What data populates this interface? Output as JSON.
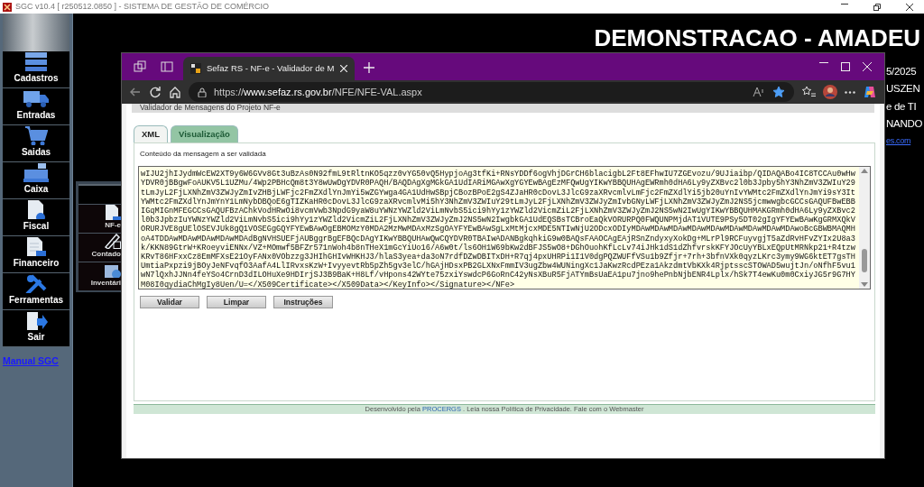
{
  "app": {
    "title": "SGC v10.4 [ r250512.0850 ] - SISTEMA DE GESTÃO DE COMÉRCIO",
    "banner": "DEMONSTRACAO - AMADEU",
    "side_texts": [
      "5/2025",
      "USZEN",
      "e de TI",
      "NANDO"
    ],
    "side_link": "es.com"
  },
  "sidebar": {
    "items": [
      {
        "label": "Cadastros"
      },
      {
        "label": "Entradas"
      },
      {
        "label": "Saidas"
      },
      {
        "label": "Caixa"
      },
      {
        "label": "Fiscal"
      },
      {
        "label": "Financeiro"
      },
      {
        "label": "Ferramentas"
      },
      {
        "label": "Sair"
      }
    ],
    "link": "Manual SGC"
  },
  "submenu": {
    "items": [
      {
        "label": "NF-e"
      },
      {
        "label": "Contado"
      },
      {
        "label": "Inventári"
      }
    ]
  },
  "browser": {
    "tab": {
      "title": "Sefaz RS - NF-e - Validador de M",
      "selected": true
    },
    "url_scheme": "https://",
    "url_domain": "www.sefaz.rs.gov.br",
    "url_path": "/NFE/NFE-VAL.aspx",
    "favorite": true
  },
  "page": {
    "header": "Validador de Mensagens do Projeto NF-e",
    "tabs": [
      {
        "label": "XML",
        "selected": true
      },
      {
        "label": "Visualização",
        "selected": false
      }
    ],
    "field_label": "Conteúdo da mensagem a ser validada",
    "message": "wIJU2jhIJydmWcEW2XT9y6W6GVv8Gt3uBzAs0N92fmL9tRltnKO5qzz0vYG50vQ5HypjoAg3tfKi+RNsYDDf6ogVhjDGrCH6blacigbL2Ft8EFhwIU7ZGEvozu/9UJiaibp/QIDAQABo4IC8TCCAu0wHwYDVR0jBBgwFoAUKV5L1UZMu/4Wp2PBHcQm8t3Y8wUwDgYDVR0PAQH/BAQDAgXgMGkGA1UdIARiMGAwXgYGYEwBAgEzMFQwUgYIKwYBBQUHAgEWRmh0dHA6Ly9yZXBvc2l0b3Jpby5hY3NhZmV3ZWIuY29tLmJyL2FjLXNhZmV3ZWJyZmIvZHBjLWFjc2FmZXdlYnJmYi5wZGYwga4GA1UdHwSBpjCBozBPoE2gS4ZJaHR0cDovL3JlcG9zaXRvcmlvLmFjc2FmZXdlYi5jb20uYnIvYWMtc2FmZXdlYnJmYi9sY3ItYWMtc2FmZXdlYnJmYnY1LmNybDBQoE6gTIZKaHR0cDovL3JlcG9zaXRvcmlvMi5hY3NhZmV3ZWIuY29tLmJyL2FjLXNhZmV3ZWJyZmIvbGNyLWFjLXNhZmV3ZWJyZmJ2NS5jcmwwgbcGCCsGAQUFBwEBBIGqMIGnMFEGCCsGAQUFBzAChkVodHRwOi8vcmVwb3NpdG9yaW8uYWNzYWZld2ViLmNvbS5ici9hYy1zYWZld2VicmZiL2FjLXNhZmV3ZWJyZmJ2NS5wN2IwUgYIKwYBBQUHMAKGRmh0dHA6Ly9yZXBvc2l0b3JpbzIuYWNzYWZld2ViLmNvbS5ici9hYy1zYWZld2VicmZiL2FjLXNhZmV3ZWJyZmJ2NS5wN2IwgbkGA1UdEQSBsTCBroEaQkVORURPQ0FWQUNPMjdAT1VUTE9PSy5DT02gIgYFYEwBAwKgGRMXQkVORURJVE8gUElOSEVJUk8gQ1VOSEGgGQYFYEwBAwOgEBMOMzY0MDA2MzMwMDAxMzSgOAYFYEwBAwSgLxMtMjcxMDE5NTIwNjU2ODcxODIyMDAwMDAwMDAwMDAwMDAwMDAwMDAwMDAwMDAwoBcGBWBMAQMHoA4TDDAwMDAwMDAwMDAwMDAdBgNVHSUEFjAUBggrBgEFBQcDAgYIKwYBBQUHAwQwCQYDVR0TBAIwADANBgkqhkiG9w0BAQsFAAOCAgEAjRSnZndyxyXokDg+MLrPl9RCFuyvgjT5aZdRvHFvZYIx2U8a3k/KKN89GtrW+KRoeyviENNx/VZ+MOmwf5BFZr571nWoh4b8nTHeX1mGcYiUo16/A6w0t/ls6OH1W69bKw2dBFJS5wO8+DGhOuohKfLcLv74iJHk1dS1dZhfvrskKFYJOcUyYBLxEQpUtMRNkp21+R4tzwKRvT86HFxxCz8EmMFXsE21OyFANx0VObzzg3JHIhGHIvWHKHJ3/hlaS3yea+da3oN7rdfDZwDBITxDH+R7qj4pxUHRPi1I1V0dgPQZWUFfVSu1b9Zfjr+7rh+3bfnVXk0qyzLKrc3ymy9WG6ktET7gsTHUmtiaPxpzi9jBOyJeNFvqfO3AafA4LlIRvxsKzW+IvyyevtRb5pZh5gv3elC/hGAjHDsxPB2GLXNxFmmIV3ugZbw4WUNingXc1JaKwzRcdPEza1AkzdmtVbKXk4RjptsscSTOWAD5wujtJn/oNfhF5vu1wN7lQxhJJNn4feYSo4CrnD3dILOHuXe9HDIrjSJ3B9BaK+H8Lf/vHpons42WYte75zxiYswdcP6GoRnC42yNsXBuR5FjATYmBsUaEA1pu7jno9hePnbNjbENR4Lplx/hSk7T4ewKu0m0CxiyJG5r9G7HYM08I0qydiaChMgIy8Uen/U=</X509Certificate></X509Data></KeyInfo></Signature></NFe>",
    "buttons": [
      "Validar",
      "Limpar",
      "Instruções"
    ],
    "footer": [
      {
        "text": "Desenvolvido pela",
        "link": false
      },
      {
        "text": "PROCERGS",
        "link": true
      },
      {
        "text": ". Leia nossa Política de Privacidade. Fale com o Webmaster",
        "link": false
      }
    ]
  }
}
